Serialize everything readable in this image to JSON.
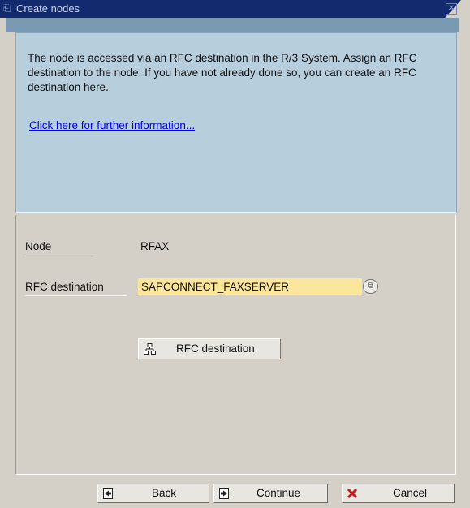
{
  "window": {
    "title": "Create nodes",
    "close_icon": "close-icon"
  },
  "info": {
    "text": "The node is accessed via an RFC destination in the R/3 System. Assign an RFC destination to the node. If you have not already done so, you can create an RFC destination here.",
    "link": "Click here for further information..."
  },
  "form": {
    "node_label": "Node",
    "node_value": "RFAX",
    "rfc_label": "RFC destination",
    "rfc_value": "SAPCONNECT_FAXSERVER",
    "rfc_button": "RFC destination"
  },
  "footer": {
    "back": "Back",
    "continue": "Continue",
    "cancel": "Cancel"
  },
  "colors": {
    "titlebar": "#142a6e",
    "info_panel": "#b7cedd",
    "input_required": "#fbe69c",
    "cancel_icon": "#c81818"
  }
}
